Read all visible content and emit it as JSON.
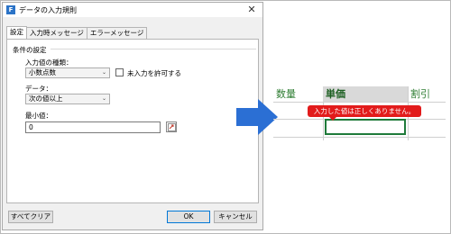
{
  "dialog": {
    "title": "データの入力規則",
    "app_icon_letter": "F",
    "close_glyph": "✕",
    "tabs": [
      {
        "label": "設定",
        "active": true
      },
      {
        "label": "入力時メッセージ",
        "active": false
      },
      {
        "label": "エラーメッセージ",
        "active": false
      }
    ],
    "group_label": "条件の設定",
    "type_label": "入力値の種類：",
    "type_value": "小数点数",
    "allow_blank_label": "未入力を許可する",
    "allow_blank_checked": false,
    "data_label": "データ：",
    "data_value": "次の値以上",
    "min_label": "最小値：",
    "min_value": "0",
    "buttons": {
      "clear_all": "すべてクリア",
      "ok": "OK",
      "cancel": "キャンセル"
    }
  },
  "arrow_color": "#2b6fd4",
  "sheet": {
    "headers": [
      "数量",
      "単価",
      "割引"
    ],
    "tooltip": "入力した値は正しくありません。",
    "tooltip_color": "#e21b1b",
    "selection_color": "#1f7a3a"
  }
}
